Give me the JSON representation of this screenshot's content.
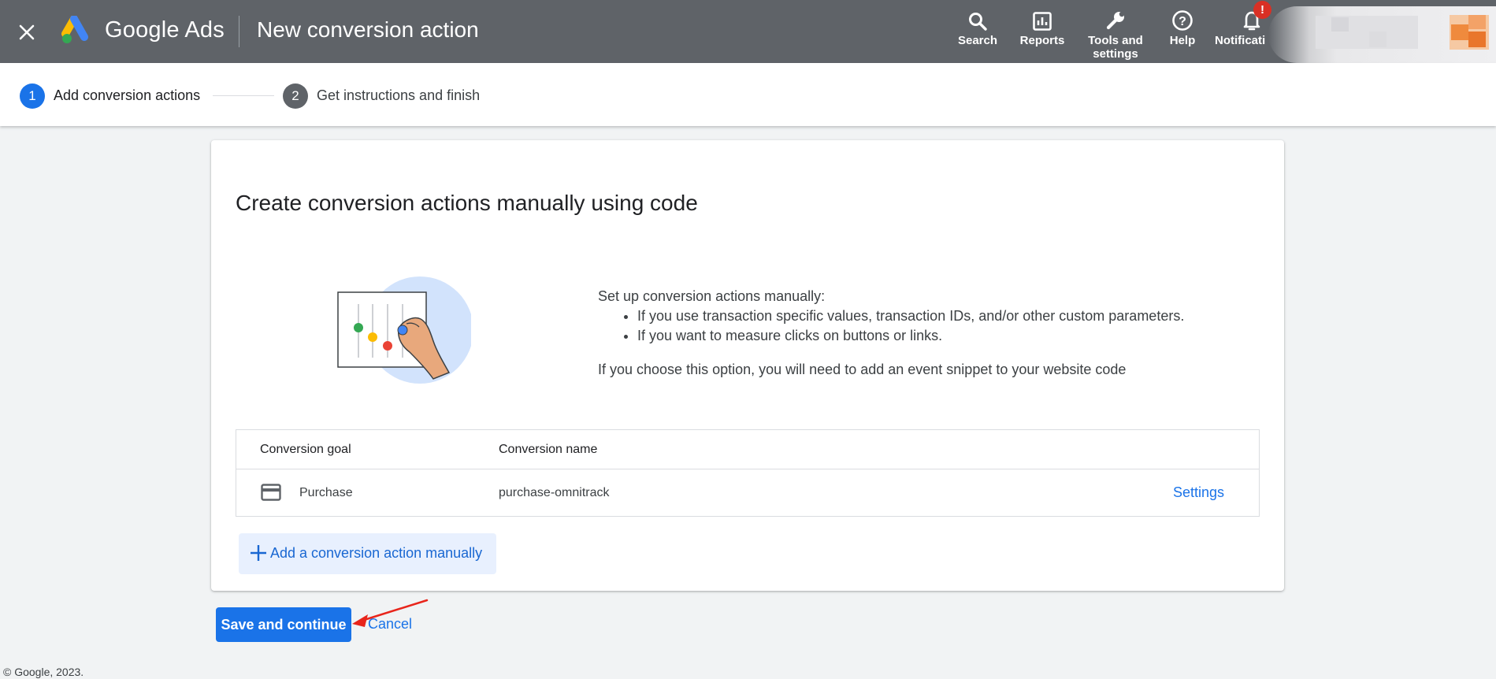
{
  "header": {
    "close_icon": "close-icon",
    "product_name": "Google Ads",
    "page_title": "New conversion action",
    "tools": [
      {
        "icon": "search-icon",
        "label": "Search"
      },
      {
        "icon": "reports-icon",
        "label": "Reports"
      },
      {
        "icon": "wrench-icon",
        "label_line1": "Tools and",
        "label_line2": "settings"
      },
      {
        "icon": "help-icon",
        "label": "Help"
      },
      {
        "icon": "bell-icon",
        "label": "Notificati"
      }
    ],
    "notification_badge": "!"
  },
  "stepper": {
    "steps": [
      {
        "number": "1",
        "label": "Add conversion actions",
        "state": "active",
        "color": "#1a73e8"
      },
      {
        "number": "2",
        "label": "Get instructions and finish",
        "state": "inactive",
        "color": "#5f6368"
      }
    ]
  },
  "card": {
    "title": "Create conversion actions manually using code",
    "intro": "Set up conversion actions manually:",
    "bullets": [
      "If you use transaction specific values, transaction IDs, and/or other custom parameters.",
      "If you want to measure clicks on buttons or links."
    ],
    "note": "If you choose this option, you will need to add an event snippet to your website code",
    "table": {
      "headers": [
        "Conversion goal",
        "Conversion name"
      ],
      "rows": [
        {
          "goal_icon": "credit-card-icon",
          "goal": "Purchase",
          "name": "purchase-omnitrack",
          "action": "Settings"
        }
      ]
    },
    "add_button": "Add a conversion action manually"
  },
  "actions": {
    "save": "Save and continue",
    "cancel": "Cancel"
  },
  "footer": {
    "copyright": "© Google, 2023."
  },
  "colors": {
    "header_bg": "#5f6368",
    "primary": "#1a73e8",
    "page_bg": "#f1f3f4",
    "badge": "#d93025"
  }
}
